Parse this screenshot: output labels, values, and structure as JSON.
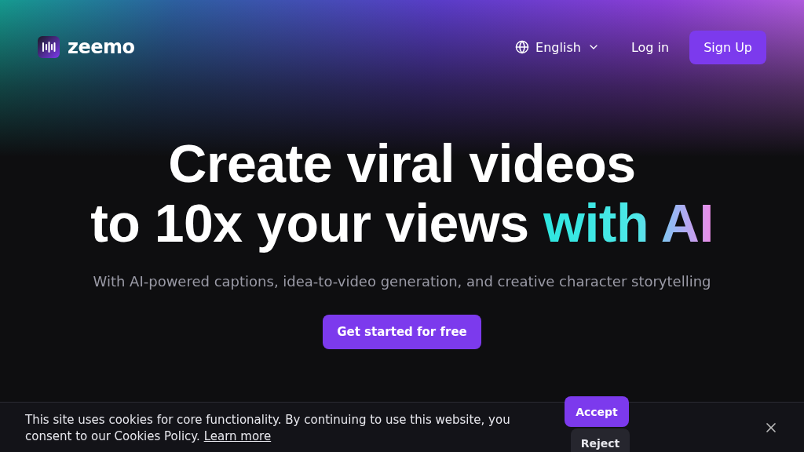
{
  "header": {
    "logo_text": "zeemo",
    "language": "English",
    "login": "Log in",
    "signup": "Sign Up"
  },
  "hero": {
    "title_lines": [
      "Create viral videos",
      "to 10x your views"
    ],
    "title_highlight": "with AI",
    "subtitle": "With AI-powered captions, idea-to-video generation, and creative character storytelling",
    "cta": "Get started for free"
  },
  "cookie_banner": {
    "text": "This site uses cookies for core functionality. By continuing to use this website, you consent to our Cookies Policy.",
    "link": "Learn more",
    "accept": "Accept",
    "reject": "Reject"
  }
}
